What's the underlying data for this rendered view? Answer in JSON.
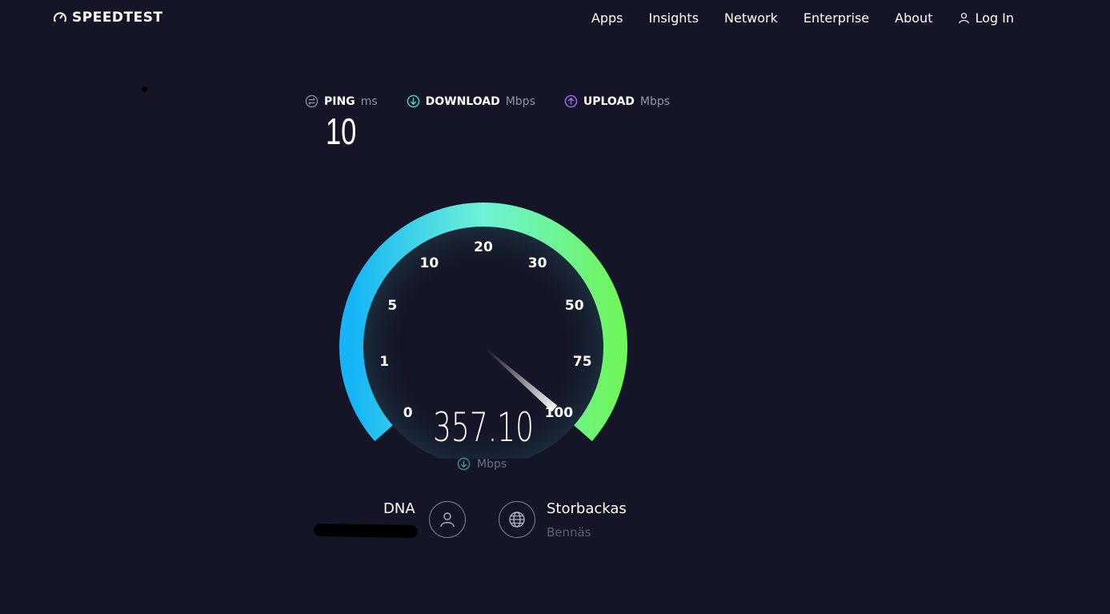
{
  "header": {
    "logo_text": "SPEEDTEST",
    "nav": [
      "Apps",
      "Insights",
      "Network",
      "Enterprise",
      "About"
    ],
    "login_label": "Log In"
  },
  "stats": {
    "ping": {
      "label": "PING",
      "unit": "ms",
      "value": "10",
      "icon": "ping-icon"
    },
    "download": {
      "label": "DOWNLOAD",
      "unit": "Mbps",
      "icon": "download-icon",
      "color": "#4fd6c0"
    },
    "upload": {
      "label": "UPLOAD",
      "unit": "Mbps",
      "icon": "upload-icon",
      "color": "#a56cf0"
    }
  },
  "gauge": {
    "ticks": [
      "0",
      "1",
      "5",
      "10",
      "20",
      "30",
      "50",
      "75",
      "100"
    ],
    "needle_value": 100,
    "speed": "357.10",
    "unit": "Mbps",
    "colors": {
      "start": "#14b4f6",
      "mid": "#6ef2d8",
      "end": "#6ff55e"
    }
  },
  "connection": {
    "isp": "DNA",
    "server_name": "Storbackas",
    "server_location": "Bennäs"
  }
}
